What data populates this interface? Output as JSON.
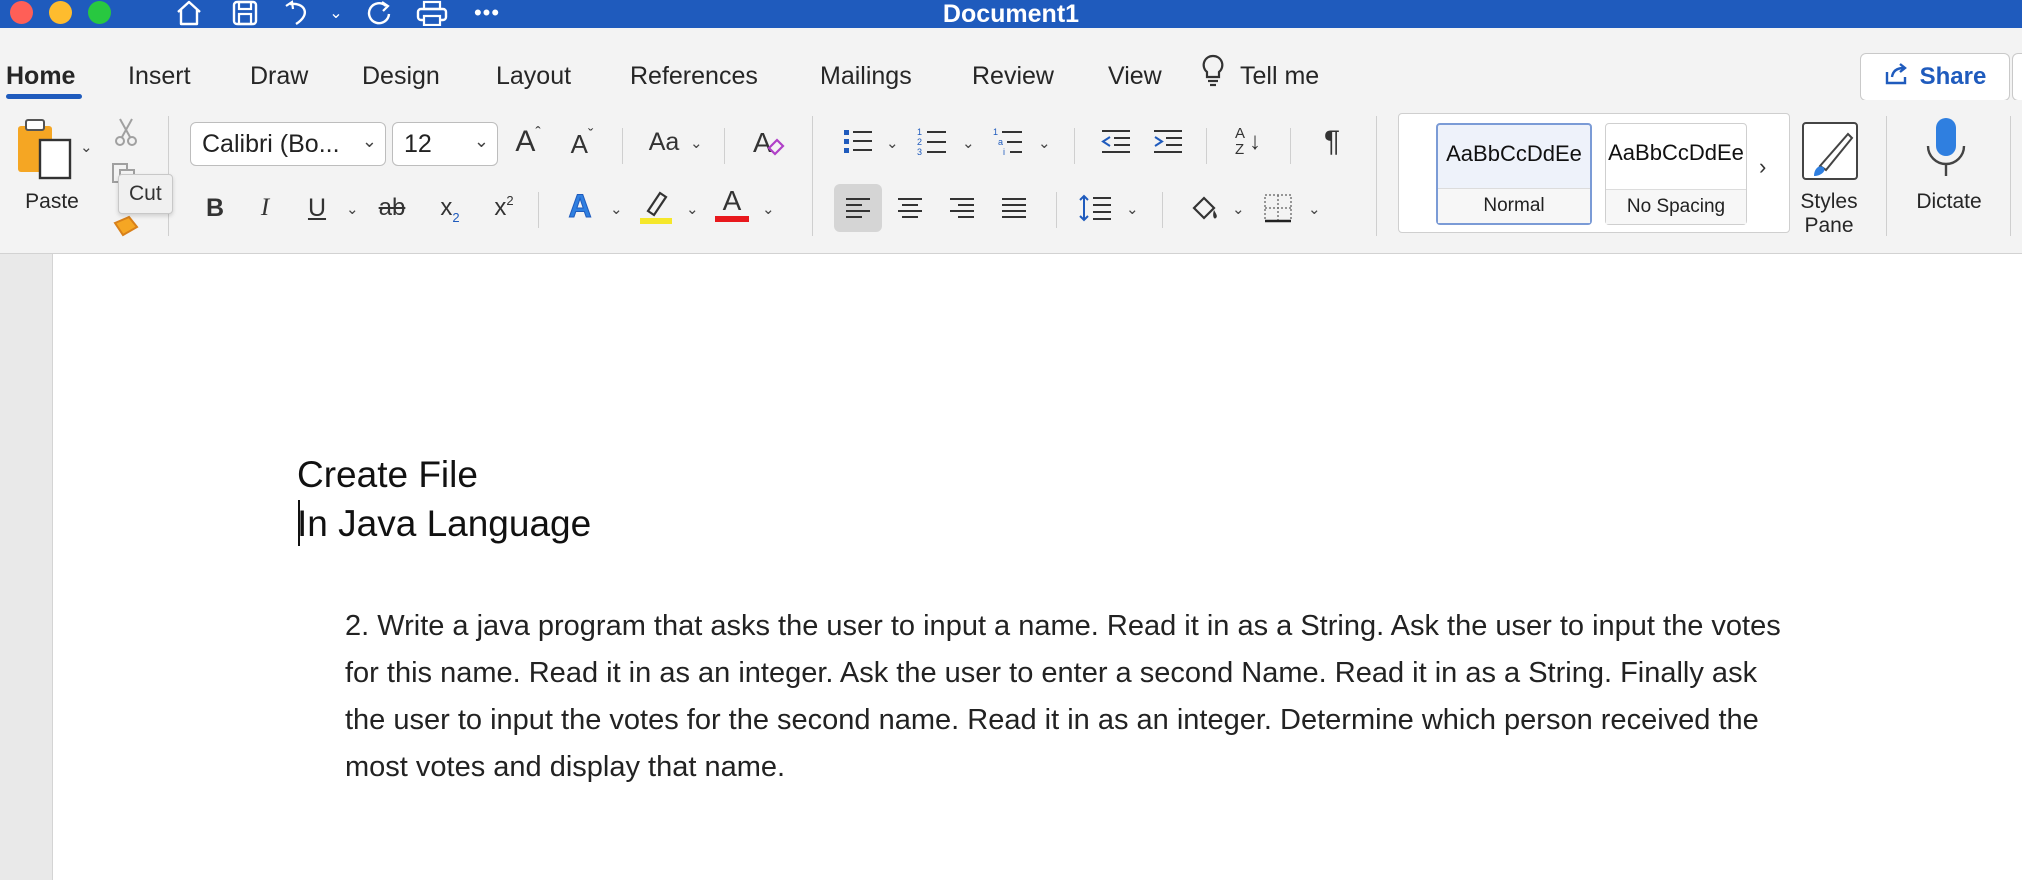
{
  "window": {
    "title": "Document1",
    "quick_access_icons": [
      "home-icon",
      "save-icon",
      "undo-icon",
      "undo-dropdown-icon",
      "redo-icon",
      "print-icon",
      "more-icon"
    ]
  },
  "tabs": [
    {
      "label": "Home",
      "active": true
    },
    {
      "label": "Insert"
    },
    {
      "label": "Draw"
    },
    {
      "label": "Design"
    },
    {
      "label": "Layout"
    },
    {
      "label": "References"
    },
    {
      "label": "Mailings"
    },
    {
      "label": "Review"
    },
    {
      "label": "View"
    }
  ],
  "tell_me": {
    "label": "Tell me"
  },
  "share": {
    "label": "Share"
  },
  "clipboard": {
    "paste_label": "Paste",
    "tooltip": "Cut"
  },
  "font": {
    "family": "Calibri (Bo...",
    "size": "12",
    "change_case_label": "Aa",
    "bold": "B",
    "italic": "I",
    "underline": "U",
    "strikethrough": "ab",
    "subscript": "x",
    "subscript_mark": "2",
    "superscript": "x",
    "superscript_mark": "2",
    "text_effects": "A",
    "font_color": "A",
    "highlight_color": "#f5e72a",
    "font_color_value": "#e8181c"
  },
  "paragraph": {
    "pilcrow": "¶",
    "sort_label_top": "A",
    "sort_label_bottom": "Z"
  },
  "styles": {
    "items": [
      {
        "sample": "AaBbCcDdEe",
        "name": "Normal",
        "selected": true
      },
      {
        "sample": "AaBbCcDdEe",
        "name": "No Spacing"
      }
    ],
    "pane_label_1": "Styles",
    "pane_label_2": "Pane"
  },
  "voice": {
    "dictate_label": "Dictate"
  },
  "document": {
    "line1": "Create File",
    "line2": "In Java Language",
    "paragraph": "2. Write a java program that asks the user to input a name. Read it in as a String. Ask the user to input the votes for this name. Read it in as an integer. Ask the user to enter a second Name. Read it in as a String. Finally ask the user to input the votes for the second name. Read it in as an integer. Determine which person received the most votes and display that name."
  },
  "colors": {
    "title_bar": "#1f5bbd",
    "accent": "#1f5bbd"
  }
}
